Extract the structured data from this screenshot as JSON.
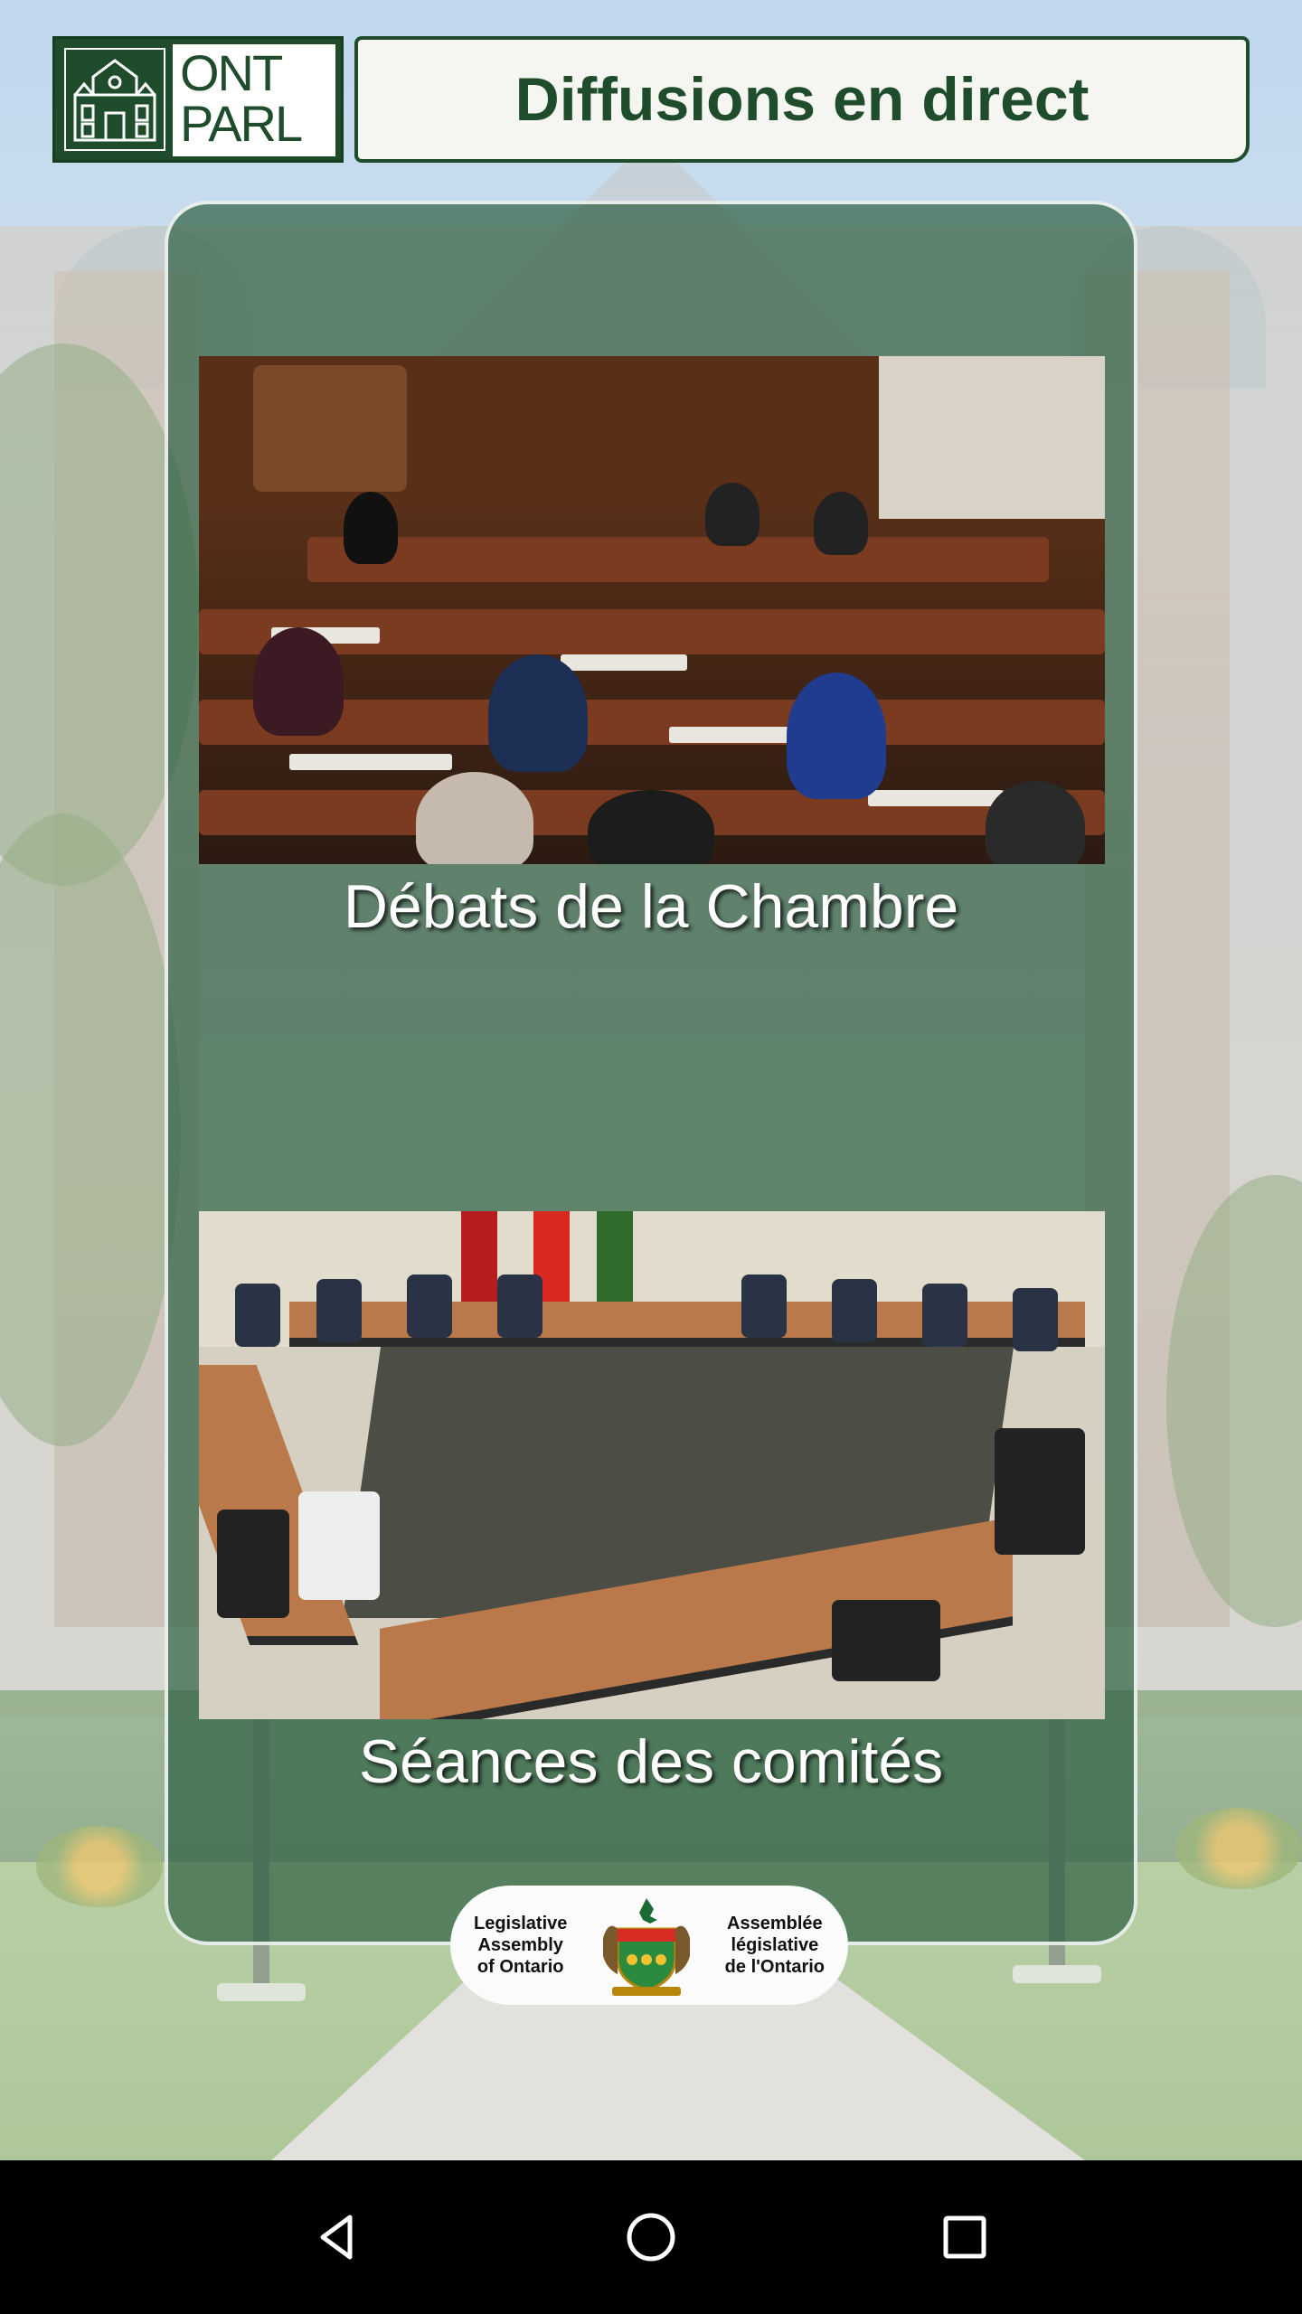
{
  "header": {
    "logo_line1": "ONT",
    "logo_line2": "PARL",
    "title": "Diffusions en direct"
  },
  "feeds": [
    {
      "label": "Débats de la Chambre",
      "image": "house-chamber-image"
    },
    {
      "label": "Séances des comités",
      "image": "committee-room-image"
    }
  ],
  "footer": {
    "left_text": "Legislative\nAssembly\nof Ontario",
    "right_text": "Assemblée\nlégislative\nde l'Ontario",
    "crest_icon": "ontario-coat-of-arms-icon"
  },
  "navbar": {
    "back_icon": "triangle-back-icon",
    "home_icon": "circle-home-icon",
    "recents_icon": "square-recents-icon"
  },
  "colors": {
    "brand_green": "#1f4d2c",
    "card_overlay": "#2d5f41",
    "navbar": "#000000"
  }
}
